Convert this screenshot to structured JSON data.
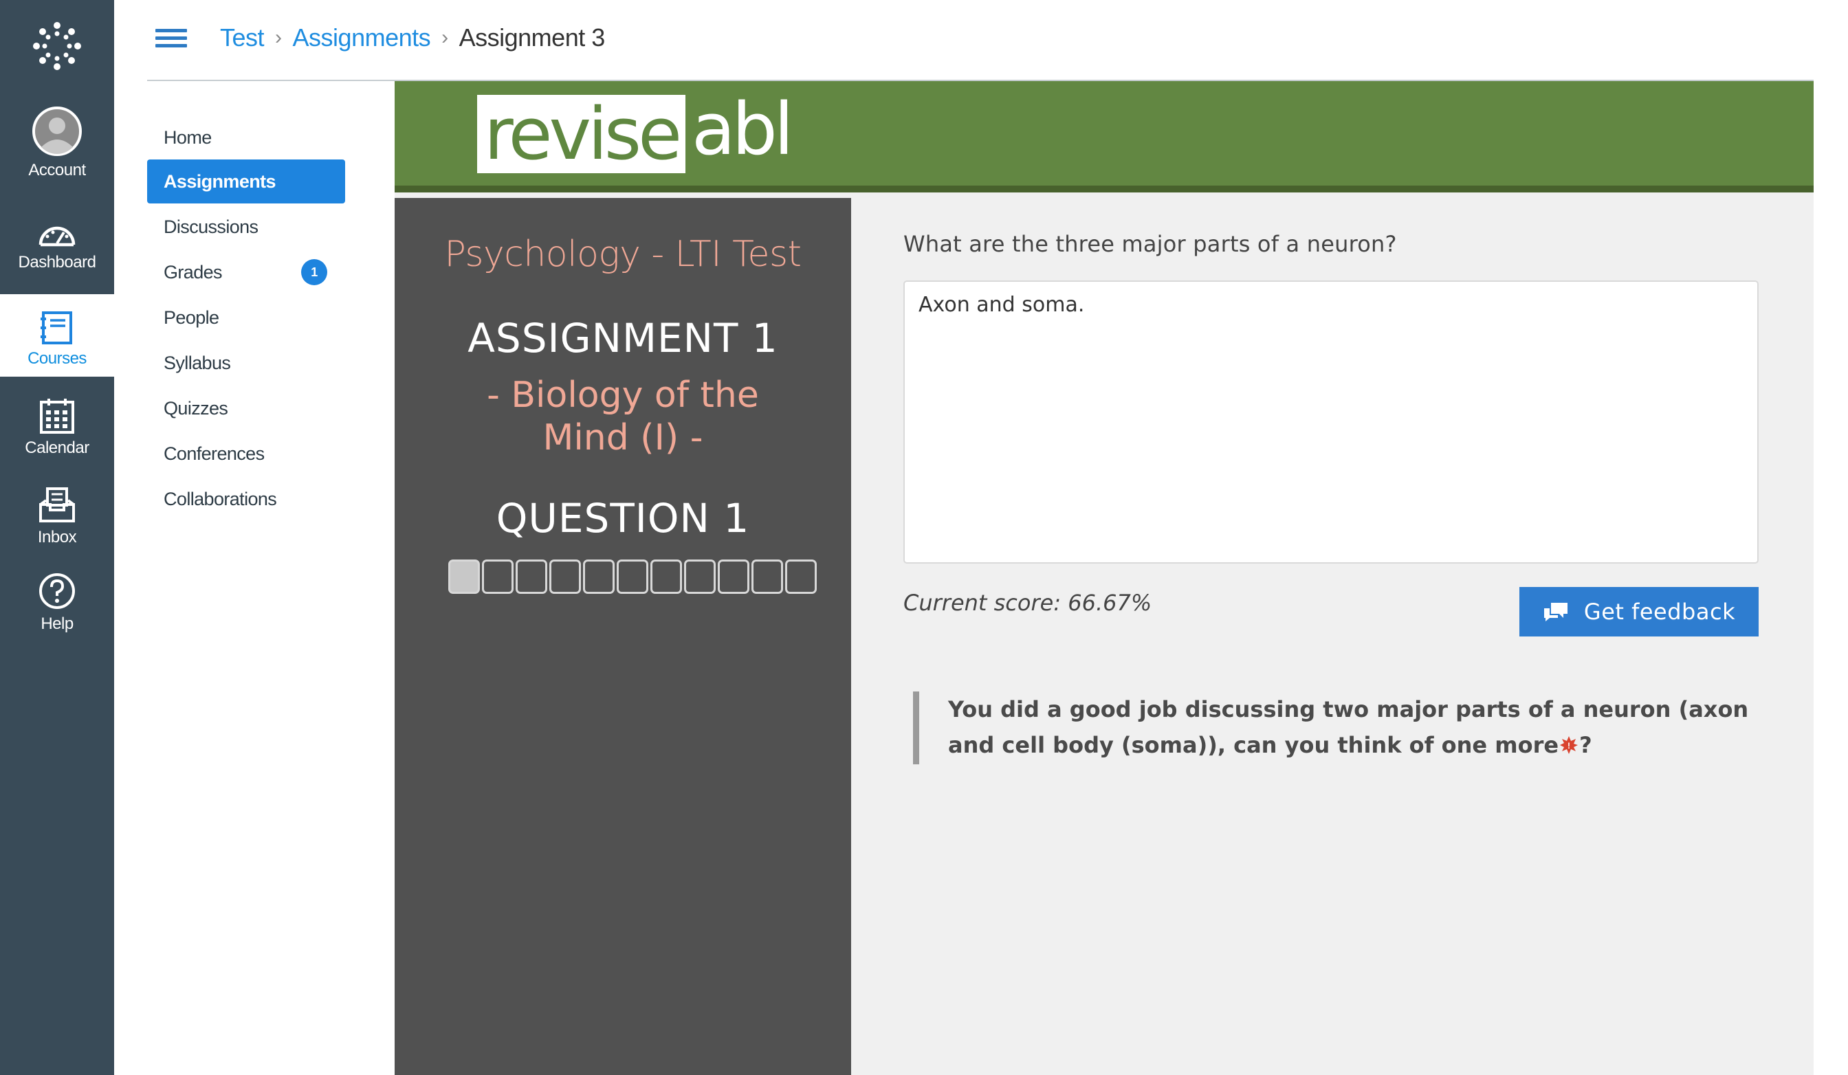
{
  "global_nav": {
    "items": [
      {
        "label": "Account",
        "icon": "avatar-icon"
      },
      {
        "label": "Dashboard",
        "icon": "dashboard-icon"
      },
      {
        "label": "Courses",
        "icon": "courses-icon"
      },
      {
        "label": "Calendar",
        "icon": "calendar-icon"
      },
      {
        "label": "Inbox",
        "icon": "inbox-icon"
      },
      {
        "label": "Help",
        "icon": "help-icon"
      }
    ],
    "active": "Courses"
  },
  "breadcrumb": {
    "items": [
      "Test",
      "Assignments",
      "Assignment 3"
    ],
    "separator": ">"
  },
  "course_nav": {
    "items": [
      {
        "label": "Home"
      },
      {
        "label": "Assignments"
      },
      {
        "label": "Discussions"
      },
      {
        "label": "Grades",
        "badge": "1"
      },
      {
        "label": "People"
      },
      {
        "label": "Syllabus"
      },
      {
        "label": "Quizzes"
      },
      {
        "label": "Conferences"
      },
      {
        "label": "Collaborations"
      }
    ],
    "active": "Assignments"
  },
  "tool": {
    "logo_revise": "revise",
    "logo_abl": "abl",
    "course_title": "Psychology - LTI Test",
    "assignment_title": "ASSIGNMENT 1",
    "assignment_subtitle": "- Biology of the Mind (I) -",
    "question_title": "QUESTION 1",
    "question_count": 11,
    "current_question": 1,
    "question_text": "What are the three major parts of a neuron?",
    "answer": "Axon and soma.",
    "score": "Current score: 66.67%",
    "feedback_button": "Get feedback",
    "feedback_part1": "You did a good job discussing two major parts of a neuron (axon and cell body (soma)), can you think of one more",
    "feedback_part2": "?"
  },
  "colors": {
    "global_nav_bg": "#394b58",
    "accent_blue": "#1e84de",
    "banner_green": "#628742",
    "panel_dark": "#515151",
    "title_salmon": "#f0a896"
  }
}
